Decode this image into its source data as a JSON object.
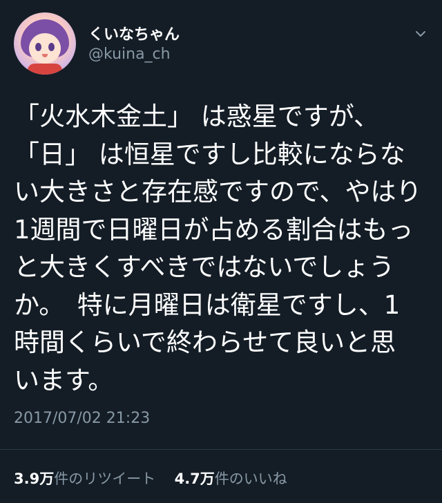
{
  "author": {
    "display_name": "くいなちゃん",
    "handle": "@kuina_ch"
  },
  "tweet": {
    "lines": [
      "「火水木金土」 は惑星ですが、",
      "「日」 は恒星ですし比較にならな",
      "い大きさと存在感ですので、やはり",
      "1週間で日曜日が占める割合はもっ",
      "と大きくすべきではないでしょう",
      "か。　特に月曜日は衛星ですし、1",
      "時間くらいで終わらせて良いと思",
      "います。"
    ],
    "timestamp": "2017/07/02 21:23"
  },
  "stats": {
    "retweets_value": "3.9万",
    "retweets_label": "件のリツイート",
    "likes_value": "4.7万",
    "likes_label": "件のいいね"
  },
  "icons": {
    "menu": "chevron-down-icon",
    "avatar": "profile-avatar"
  },
  "colors": {
    "background": "#141d26",
    "primary_text": "#ffffff",
    "secondary_text": "#8899a6"
  }
}
